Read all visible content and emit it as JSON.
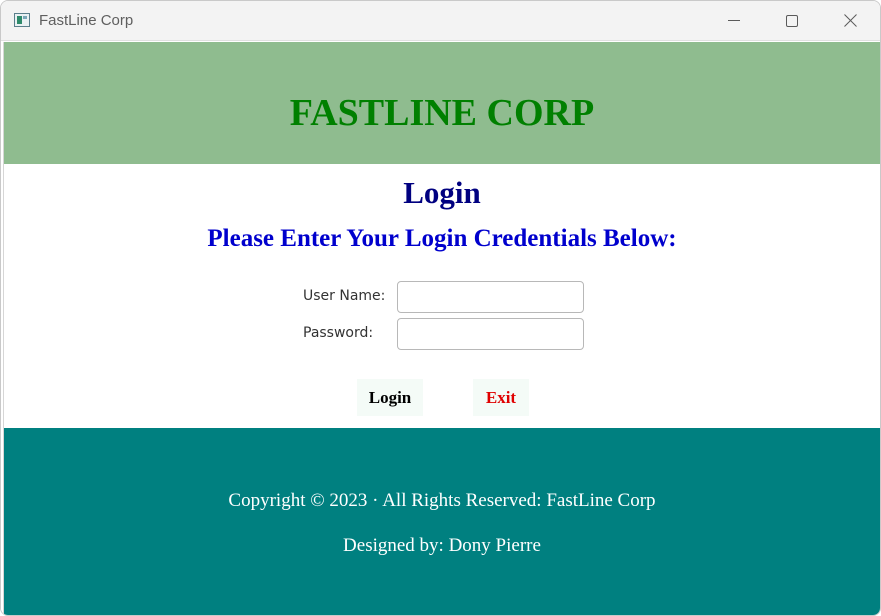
{
  "window": {
    "title": "FastLine Corp",
    "controls": {
      "minimize": "minimize-icon",
      "maximize": "maximize-icon",
      "close": "close-icon"
    }
  },
  "header": {
    "brand": "FASTLINE CORP"
  },
  "login": {
    "heading": "Login",
    "instructions": "Please Enter Your Login Credentials Below:",
    "username_label": "User Name:",
    "username_value": "",
    "password_label": "Password:",
    "password_value": "",
    "login_button": "Login",
    "exit_button": "Exit"
  },
  "footer": {
    "copyright": "Copyright © 2023 · All Rights Reserved: FastLine Corp",
    "designer": "Designed by: Dony Pierre"
  },
  "colors": {
    "header_band": "#8fbc8f",
    "brand_text": "#008000",
    "heading_text": "#000080",
    "instructions_text": "#0000cd",
    "exit_text": "#e00000",
    "footer_band": "#008080"
  }
}
